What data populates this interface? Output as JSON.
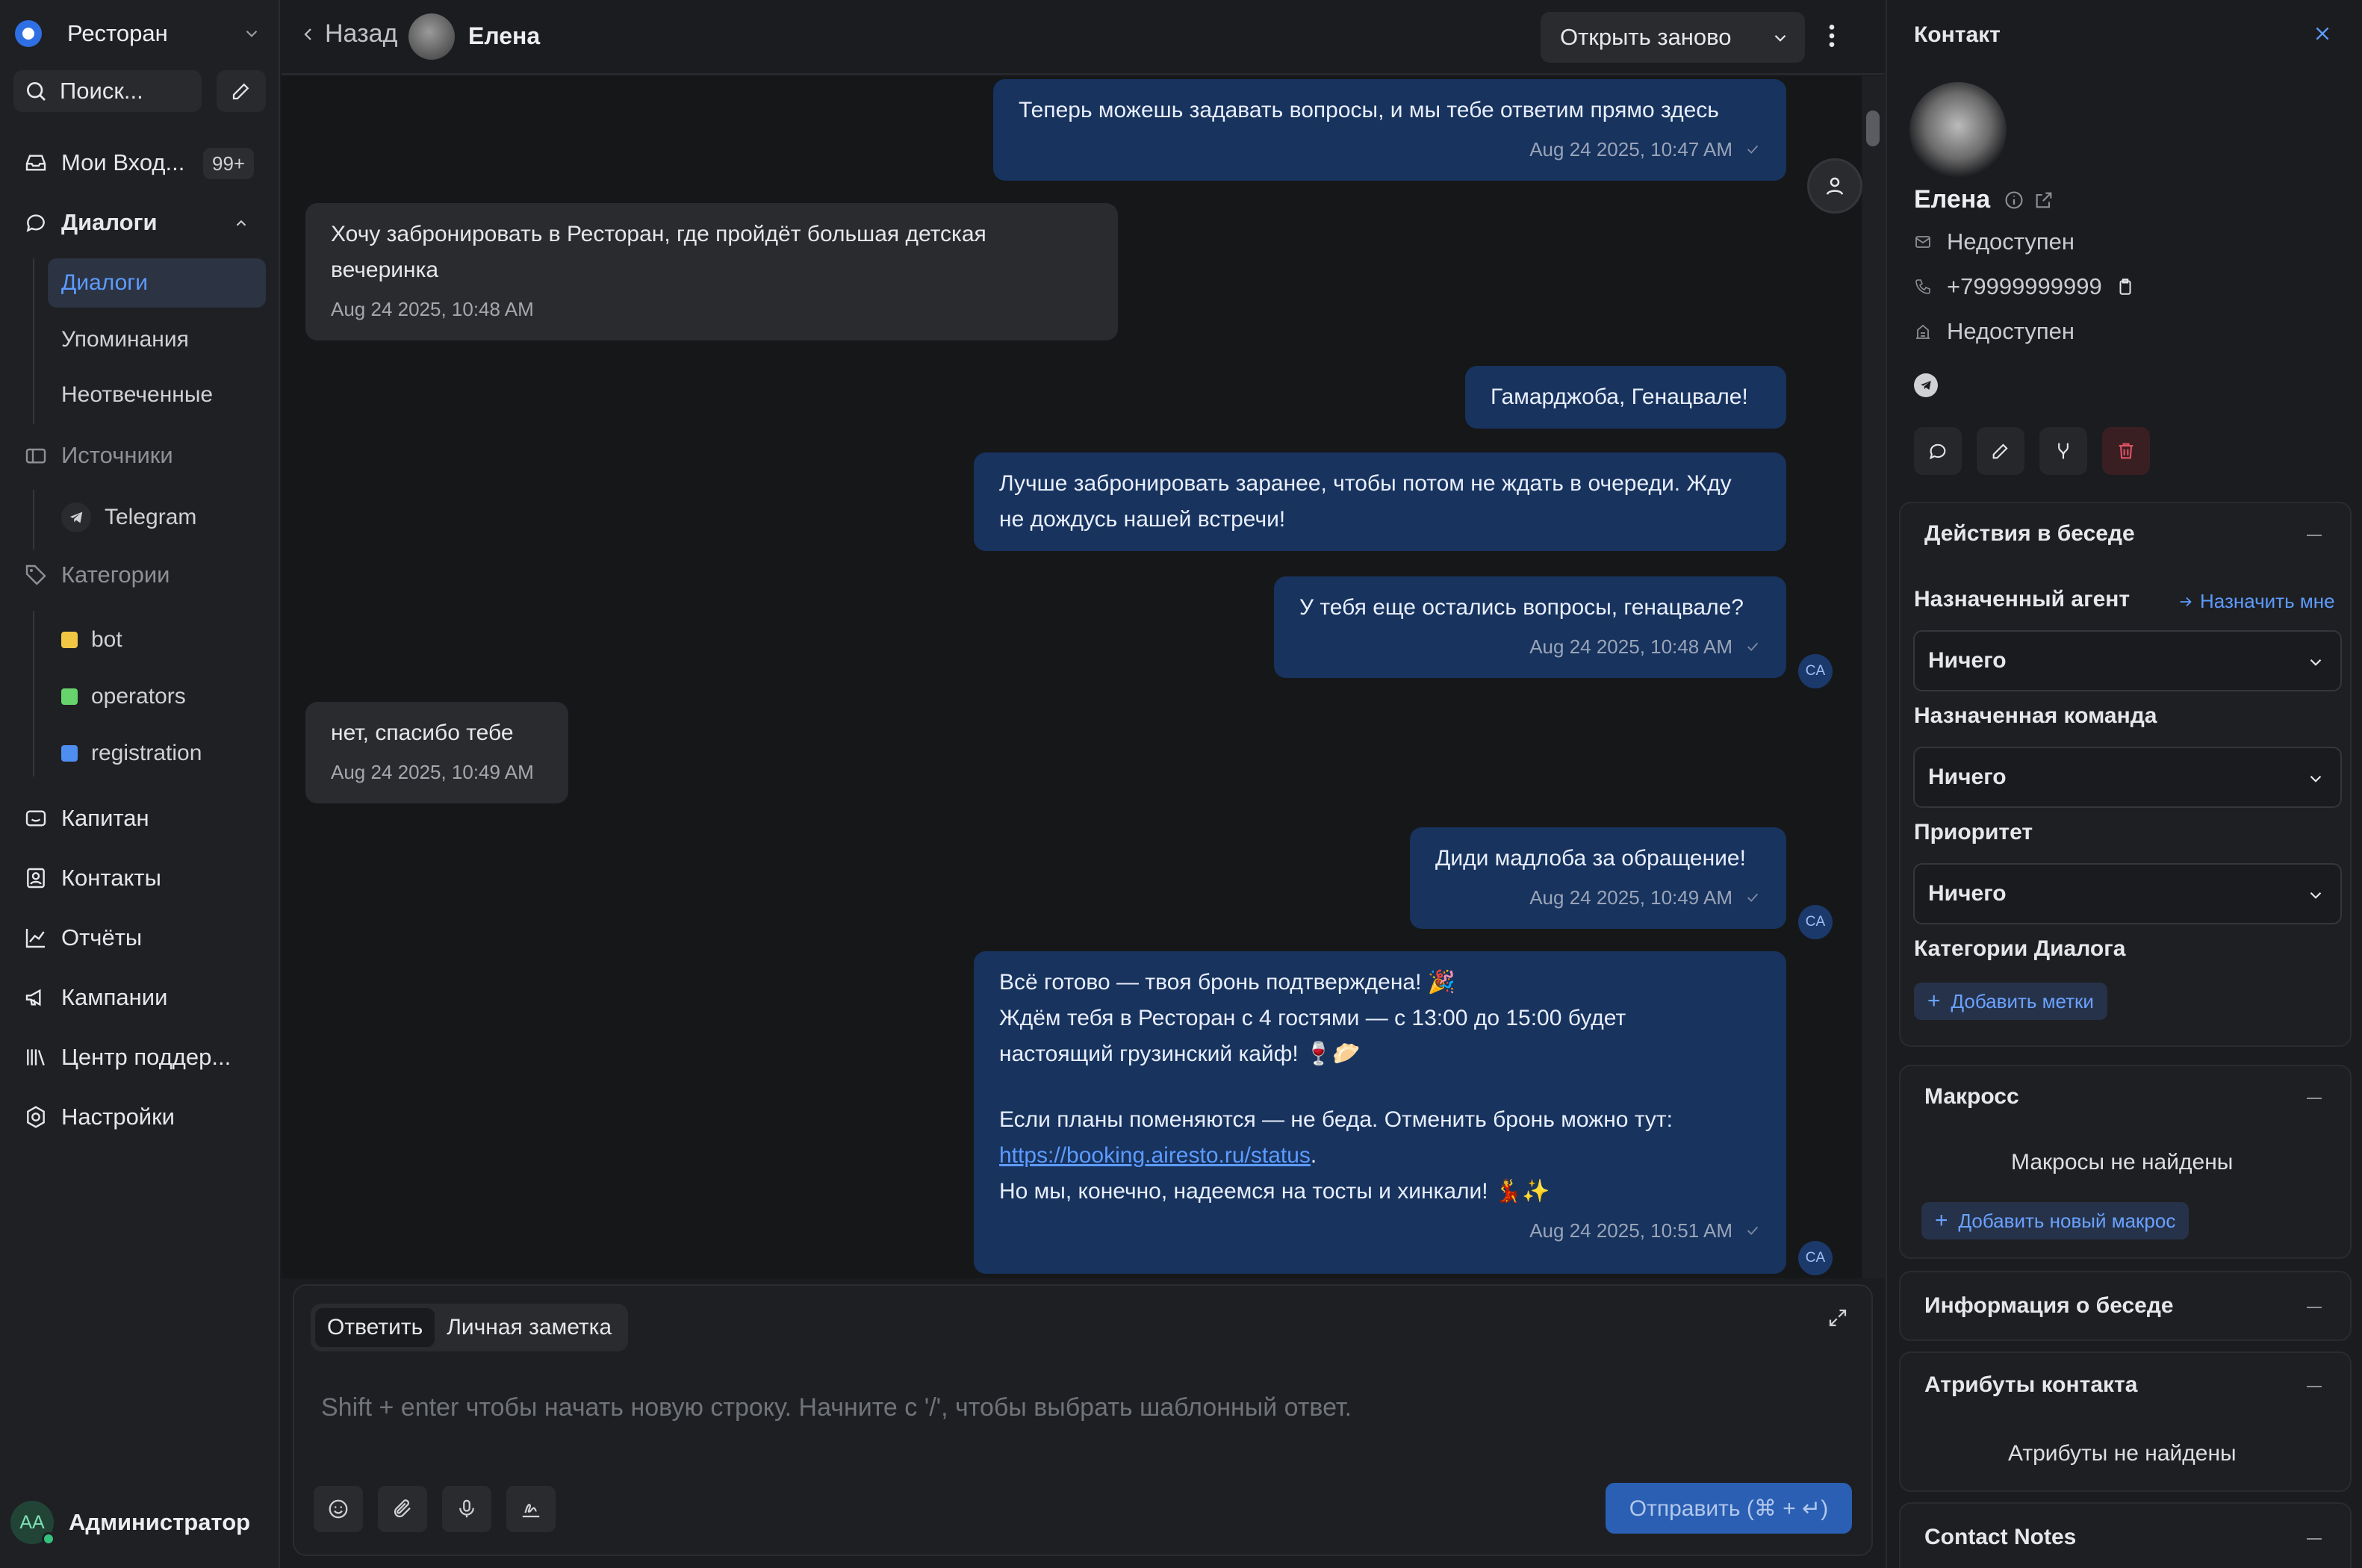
{
  "sidebar": {
    "workspace": "Ресторан",
    "search_placeholder": "Поиск...",
    "inbox_label": "Мои Вход...",
    "inbox_badge": "99+",
    "conversations_label": "Диалоги",
    "conv_sub": [
      "Диалоги",
      "Упоминания",
      "Неотвеченные"
    ],
    "sources_label": "Источники",
    "source_telegram": "Telegram",
    "categories_label": "Категории",
    "categories": [
      {
        "label": "bot",
        "color": "#f2c744"
      },
      {
        "label": "operators",
        "color": "#67d36d"
      },
      {
        "label": "registration",
        "color": "#4d8ef0"
      }
    ],
    "captain": "Капитан",
    "contacts": "Контакты",
    "reports": "Отчёты",
    "campaigns": "Кампании",
    "help_center": "Центр поддер...",
    "settings": "Настройки",
    "admin_initials": "AA",
    "admin_name": "Администратор"
  },
  "topbar": {
    "back_label": "Назад",
    "contact_name": "Елена",
    "reopen_label": "Открыть заново"
  },
  "messages": [
    {
      "dir": "out",
      "text": "Теперь можешь задавать вопросы, и мы тебе ответим прямо здесь",
      "time": "Aug 24 2025, 10:47 AM"
    },
    {
      "dir": "in",
      "text": "Хочу забронировать в Ресторан, где пройдёт большая детская вечеринка",
      "time": "Aug 24 2025, 10:48 AM"
    },
    {
      "dir": "out",
      "text": "Гамарджоба, Генацвале!"
    },
    {
      "dir": "out",
      "text": "Лучше забронировать заранее, чтобы потом не ждать в очереди. Жду не дождусь нашей встречи!"
    },
    {
      "dir": "out",
      "text": "У тебя еще остались вопросы, генацвале?",
      "time": "Aug 24 2025, 10:48 AM",
      "avatar": "CA"
    },
    {
      "dir": "in",
      "text": "нет, спасибо тебе",
      "time": "Aug 24 2025, 10:49 AM"
    },
    {
      "dir": "out",
      "text": "Диди мадлоба за обращение!",
      "time": "Aug 24 2025, 10:49 AM",
      "avatar": "CA"
    },
    {
      "dir": "out",
      "line1": "Всё готово — твоя бронь подтверждена! 🎉",
      "line2": "Ждём тебя в Ресторан с 4 гостями — с 13:00 до 15:00 будет",
      "line3": "настоящий грузинский кайф! 🍷🥟",
      "line4": "Если планы поменяются — не беда. Отменить бронь можно тут:",
      "link": "https://booking.airesto.ru/status",
      "line5": "Но мы, конечно, надеемся на тосты и хинкали! 💃✨",
      "time": "Aug 24 2025, 10:51 AM",
      "avatar": "CA"
    }
  ],
  "composer": {
    "tab_reply": "Ответить",
    "tab_note": "Личная заметка",
    "placeholder": "Shift + enter чтобы начать новую строку. Начните с '/', чтобы выбрать шаблонный ответ.",
    "send_label": "Отправить (⌘ + ↵)"
  },
  "contact_panel": {
    "title": "Контакт",
    "name": "Елена",
    "email": "Недоступен",
    "phone": "+79999999999",
    "company": "Недоступен",
    "actions_title": "Действия в беседе",
    "assigned_agent_label": "Назначенный агент",
    "assign_me": "Назначить мне",
    "assigned_agent_value": "Ничего",
    "assigned_team_label": "Назначенная команда",
    "assigned_team_value": "Ничего",
    "priority_label": "Приоритет",
    "priority_value": "Ничего",
    "categories_label": "Категории Диалога",
    "add_labels": "Добавить метки",
    "macros_title": "Макросс",
    "macros_empty": "Макросы не найдены",
    "add_macro": "Добавить новый макрос",
    "conv_info_title": "Информация о беседе",
    "contact_attrs_title": "Атрибуты контакта",
    "contact_attrs_empty": "Атрибуты не найдены",
    "contact_notes_title": "Contact Notes"
  }
}
